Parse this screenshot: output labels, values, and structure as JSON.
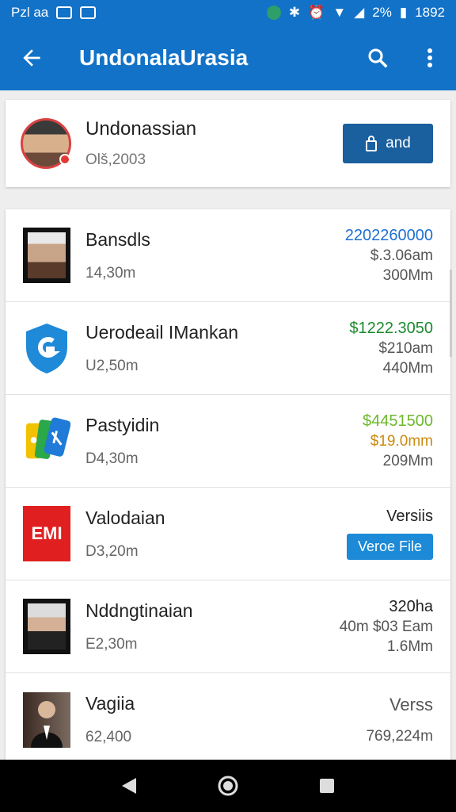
{
  "status": {
    "left_text": "Pzl aa",
    "battery": "2%",
    "time": "1892"
  },
  "appbar": {
    "title": "UndonalaUrasia"
  },
  "profile": {
    "name": "Undonassian",
    "sub": "Olš,2003",
    "button_label": "and"
  },
  "rows": [
    {
      "title": "Bansdls",
      "sub": "14,30m",
      "r1": "2202260000",
      "r1_color": "#1f6fd1",
      "r2": "$.3.06am",
      "r3": "300Mm",
      "thumb": "portrait"
    },
    {
      "title": "Uerodeail IMankan",
      "sub": "U2,50m",
      "r1": "$1222.3050",
      "r1_color": "#1b8a2e",
      "r2": "$210am",
      "r3": "440Mm",
      "thumb": "shield"
    },
    {
      "title": "Pastyidin",
      "sub": "D4,30m",
      "r1": "$4451500",
      "r1_color": "#6bb82a",
      "r2": "$19.0mm",
      "r2_color": "#c98a10",
      "r3": "209Mm",
      "thumb": "multi"
    },
    {
      "title": "Valodaian",
      "sub": "D3,20m",
      "r1": "Versiis",
      "r1_color": "#222222",
      "pill": "Veroe File",
      "thumb": "red",
      "thumb_text": "EMI"
    },
    {
      "title": "Nddngtinaian",
      "sub": "E2,30m",
      "r1": "320ha",
      "r1_color": "#222222",
      "r2": "40m $03 Eam",
      "r3": "1.6Mm",
      "thumb": "portrait2"
    },
    {
      "title": "Vagiia",
      "sub": "62,400",
      "r1": "Verss",
      "r1_color": "#555555",
      "r2": "769,224m",
      "thumb": "photo"
    }
  ]
}
